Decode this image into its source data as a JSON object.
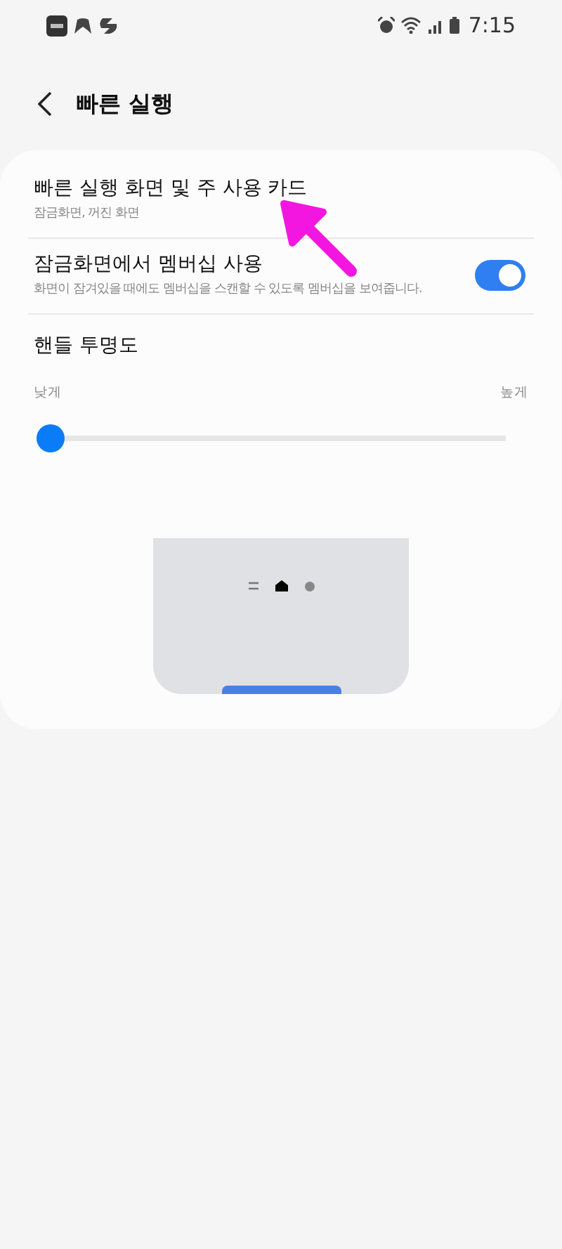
{
  "status_bar": {
    "time": "7:15"
  },
  "header": {
    "title": "빠른 실행"
  },
  "settings": [
    {
      "kind": "link",
      "title": "빠른 실행 화면 및 주 사용 카드",
      "subtitle": "잠금화면, 꺼진 화면"
    },
    {
      "kind": "toggle",
      "title": "잠금화면에서 멤버십 사용",
      "subtitle": "화면이 잠겨있을 때에도 멤버십을 스캔할 수 있도록 멤버십을 보여줍니다.",
      "on": true
    },
    {
      "kind": "slider",
      "title": "핸들 투명도",
      "min_label": "낮게",
      "max_label": "높게",
      "level": 0
    }
  ]
}
